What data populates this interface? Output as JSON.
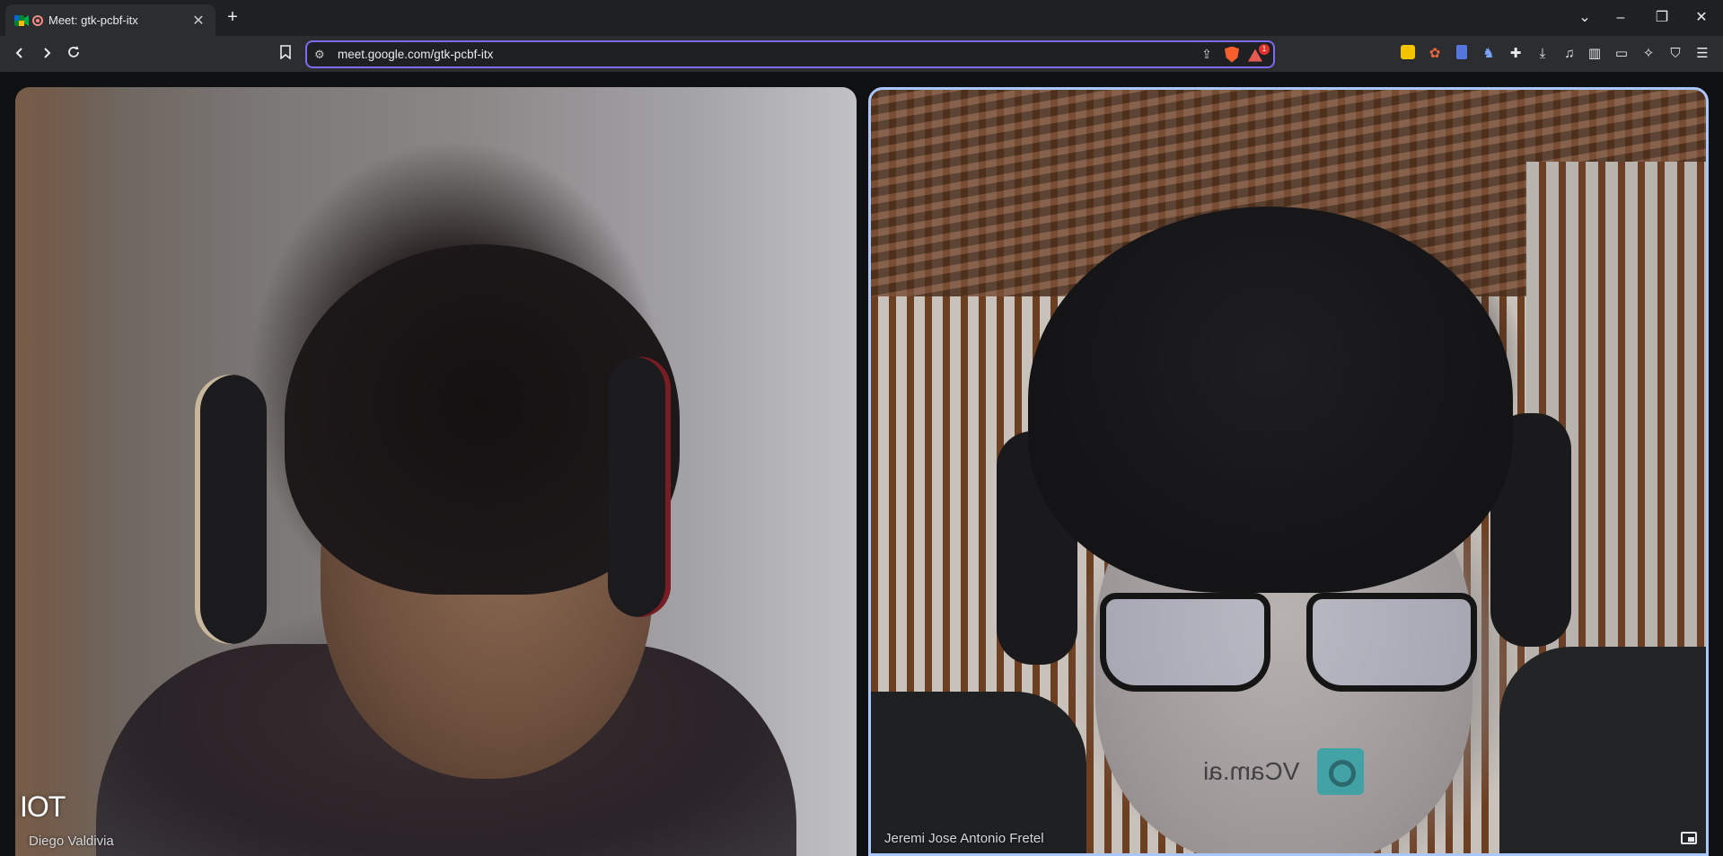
{
  "browser": {
    "tab": {
      "title": "Meet: gtk-pcbf-itx"
    },
    "url": "meet.google.com/gtk-pcbf-itx",
    "rewards_badge": "1",
    "accent_color": "#7b6cf0"
  },
  "meet": {
    "tiles": [
      {
        "name": "Diego Valdivia",
        "overlay_text": "IOT"
      },
      {
        "name": "Jeremi Jose Antonio Fretel",
        "watermark": "VCam.ai",
        "active_speaker_color": "#a8c7fa"
      }
    ]
  }
}
